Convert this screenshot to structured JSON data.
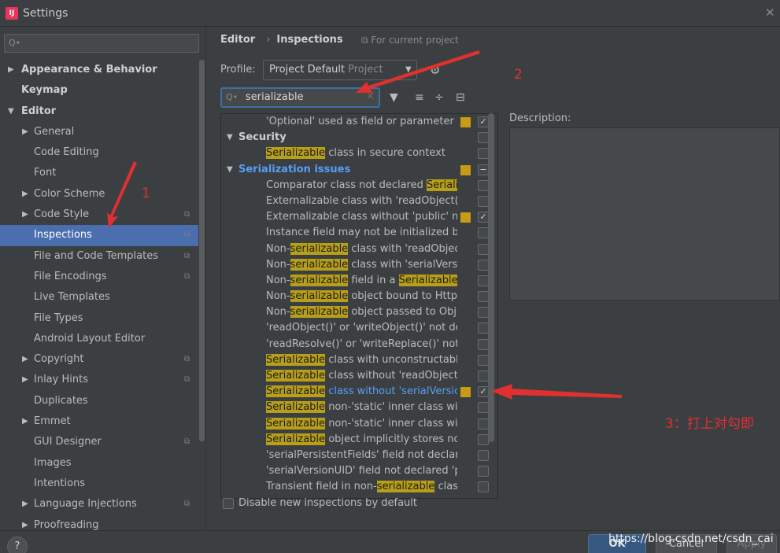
{
  "window": {
    "title": "Settings"
  },
  "sidebar": {
    "search_placeholder": "Q•",
    "items": [
      {
        "label": "Appearance & Behavior",
        "arrow": "▶",
        "bold": true,
        "indent": 1
      },
      {
        "label": "Keymap",
        "arrow": "",
        "bold": true,
        "indent": 1
      },
      {
        "label": "Editor",
        "arrow": "▼",
        "bold": true,
        "indent": 1
      },
      {
        "label": "General",
        "arrow": "▶",
        "indent": 2
      },
      {
        "label": "Code Editing",
        "arrow": "",
        "indent": 2
      },
      {
        "label": "Font",
        "arrow": "",
        "indent": 2
      },
      {
        "label": "Color Scheme",
        "arrow": "▶",
        "indent": 2
      },
      {
        "label": "Code Style",
        "arrow": "▶",
        "indent": 2,
        "project": true
      },
      {
        "label": "Inspections",
        "arrow": "",
        "indent": 2,
        "project": true,
        "selected": true
      },
      {
        "label": "File and Code Templates",
        "arrow": "",
        "indent": 2,
        "project": true
      },
      {
        "label": "File Encodings",
        "arrow": "",
        "indent": 2,
        "project": true
      },
      {
        "label": "Live Templates",
        "arrow": "",
        "indent": 2
      },
      {
        "label": "File Types",
        "arrow": "",
        "indent": 2
      },
      {
        "label": "Android Layout Editor",
        "arrow": "",
        "indent": 2
      },
      {
        "label": "Copyright",
        "arrow": "▶",
        "indent": 2,
        "project": true
      },
      {
        "label": "Inlay Hints",
        "arrow": "▶",
        "indent": 2,
        "project": true
      },
      {
        "label": "Duplicates",
        "arrow": "",
        "indent": 2
      },
      {
        "label": "Emmet",
        "arrow": "▶",
        "indent": 2
      },
      {
        "label": "GUI Designer",
        "arrow": "",
        "indent": 2,
        "project": true
      },
      {
        "label": "Images",
        "arrow": "",
        "indent": 2
      },
      {
        "label": "Intentions",
        "arrow": "",
        "indent": 2
      },
      {
        "label": "Language Injections",
        "arrow": "▶",
        "indent": 2,
        "project": true
      },
      {
        "label": "Proofreading",
        "arrow": "▶",
        "indent": 2
      }
    ]
  },
  "header": {
    "crumb_editor": "Editor",
    "crumb_sep": "›",
    "crumb_inspections": "Inspections",
    "for_project": "⧉ For current project"
  },
  "profile": {
    "label": "Profile:",
    "value": "Project Default",
    "sub": "Project"
  },
  "search": {
    "value": "serializable",
    "clear": "×"
  },
  "inspections": [
    {
      "parts": [
        [
          "t",
          "'Optional' used as field or parameter ty"
        ]
      ],
      "swatch": true,
      "checked": true
    },
    {
      "category": "Security",
      "open": true
    },
    {
      "parts": [
        [
          "h",
          "Serializable"
        ],
        [
          "t",
          " class in secure context"
        ]
      ],
      "checked": false
    },
    {
      "category": "Serialization issues",
      "open": true,
      "blue": true,
      "swatch": true,
      "mixed": true
    },
    {
      "parts": [
        [
          "t",
          "Comparator class not declared "
        ],
        [
          "h",
          "Serializa"
        ]
      ],
      "checked": false
    },
    {
      "parts": [
        [
          "t",
          "Externalizable class with 'readObject()' c"
        ]
      ],
      "checked": false
    },
    {
      "parts": [
        [
          "t",
          "Externalizable class without 'public' no-"
        ]
      ],
      "swatch": true,
      "checked": true
    },
    {
      "parts": [
        [
          "t",
          "Instance field may not be initialized by '"
        ]
      ],
      "checked": false
    },
    {
      "parts": [
        [
          "t",
          "Non-"
        ],
        [
          "h",
          "serializable"
        ],
        [
          "t",
          " class with 'readObject('"
        ]
      ],
      "checked": false
    },
    {
      "parts": [
        [
          "t",
          "Non-"
        ],
        [
          "h",
          "serializable"
        ],
        [
          "t",
          " class with 'serialVersion"
        ]
      ],
      "checked": false
    },
    {
      "parts": [
        [
          "t",
          "Non-"
        ],
        [
          "h",
          "serializable"
        ],
        [
          "t",
          " field in a "
        ],
        [
          "h",
          "Serializable"
        ],
        [
          "t",
          " cl"
        ]
      ],
      "checked": false
    },
    {
      "parts": [
        [
          "t",
          "Non-"
        ],
        [
          "h",
          "serializable"
        ],
        [
          "t",
          " object bound to HttpSe"
        ]
      ],
      "checked": false
    },
    {
      "parts": [
        [
          "t",
          "Non-"
        ],
        [
          "h",
          "serializable"
        ],
        [
          "t",
          " object passed to Objec"
        ]
      ],
      "checked": false
    },
    {
      "parts": [
        [
          "t",
          "'readObject()' or 'writeObject()' not decl"
        ]
      ],
      "checked": false
    },
    {
      "parts": [
        [
          "t",
          "'readResolve()' or 'writeReplace()' not de"
        ]
      ],
      "checked": false
    },
    {
      "parts": [
        [
          "h",
          "Serializable"
        ],
        [
          "t",
          " class with unconstructable a"
        ]
      ],
      "checked": false
    },
    {
      "parts": [
        [
          "h",
          "Serializable"
        ],
        [
          "t",
          " class without 'readObject()'"
        ]
      ],
      "checked": false
    },
    {
      "parts": [
        [
          "h",
          "Serializable"
        ],
        [
          "b",
          " class without 'serialVersionU"
        ]
      ],
      "swatch": true,
      "checked": true
    },
    {
      "parts": [
        [
          "h",
          "Serializable"
        ],
        [
          "t",
          " non-'static' inner class with"
        ]
      ],
      "checked": false
    },
    {
      "parts": [
        [
          "h",
          "Serializable"
        ],
        [
          "t",
          " non-'static' inner class witho"
        ]
      ],
      "checked": false
    },
    {
      "parts": [
        [
          "h",
          "Serializable"
        ],
        [
          "t",
          " object implicitly stores non-"
        ]
      ],
      "checked": false
    },
    {
      "parts": [
        [
          "t",
          "'serialPersistentFields' field not declared"
        ]
      ],
      "checked": false
    },
    {
      "parts": [
        [
          "t",
          "'serialVersionUID' field not declared 'pri"
        ]
      ],
      "checked": false
    },
    {
      "parts": [
        [
          "t",
          "Transient field in non-"
        ],
        [
          "h",
          "serializable"
        ],
        [
          "t",
          " class"
        ]
      ],
      "checked": false
    }
  ],
  "description": {
    "label": "Description:"
  },
  "disable_new": {
    "label": "Disable new inspections by default"
  },
  "buttons": {
    "help": "?",
    "ok": "OK",
    "cancel": "Cancel",
    "apply": "Apply"
  },
  "annotations": {
    "a1": "1",
    "a2": "2",
    "a3": "3：打上对勾即"
  },
  "watermark": "https://blog.csdn.net/csdn_cai",
  "icons": {
    "filter": "filter-icon",
    "expand": "expand-all-icon",
    "collapse": "collapse-all-icon",
    "reset": "reset-icon",
    "gear": "gear-icon"
  },
  "colors": {
    "accent": "#4b6eaf",
    "highlight": "#b89f1a",
    "annotation": "#e03030",
    "link": "#589df6"
  }
}
